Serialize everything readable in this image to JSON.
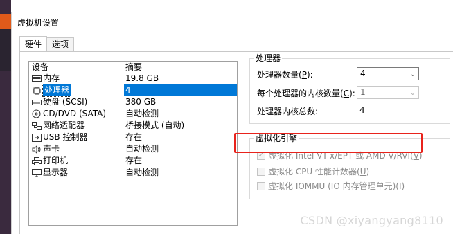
{
  "window": {
    "title": "虚拟机设置"
  },
  "tabs": [
    {
      "label": "硬件"
    },
    {
      "label": "选项"
    }
  ],
  "device_list": {
    "headers": {
      "device": "设备",
      "summary": "摘要"
    },
    "rows": [
      {
        "icon": "memory-icon",
        "name": "内存",
        "summary": "19.8 GB"
      },
      {
        "icon": "cpu-icon",
        "name": "处理器",
        "summary": "4"
      },
      {
        "icon": "hard-disk-icon",
        "name": "硬盘 (SCSI)",
        "summary": "380 GB"
      },
      {
        "icon": "cd-dvd-icon",
        "name": "CD/DVD (SATA)",
        "summary": "自动检测"
      },
      {
        "icon": "network-adapter-icon",
        "name": "网络适配器",
        "summary": "桥接模式 (自动)"
      },
      {
        "icon": "usb-controller-icon",
        "name": "USB 控制器",
        "summary": "存在"
      },
      {
        "icon": "sound-card-icon",
        "name": "声卡",
        "summary": "自动检测"
      },
      {
        "icon": "printer-icon",
        "name": "打印机",
        "summary": "存在"
      },
      {
        "icon": "display-icon",
        "name": "显示器",
        "summary": "自动检测"
      }
    ]
  },
  "processor_group": {
    "title": "处理器",
    "num_processors_label": "处理器数量(",
    "num_processors_key": "P",
    "num_processors_suffix": "):",
    "num_processors_value": "4",
    "cores_per_proc_label": "每个处理器的内核数量(",
    "cores_per_proc_key": "C",
    "cores_per_proc_suffix": "):",
    "cores_per_proc_value": "1",
    "total_cores_label": "处理器内核总数:",
    "total_cores_value": "4"
  },
  "virt_group": {
    "title": "虚拟化引擎",
    "options": [
      {
        "label": "虚拟化 Intel VT-x/EPT 或 AMD-V/RVI(",
        "key": "V",
        "suffix": ")",
        "checked": true,
        "highlighted": true
      },
      {
        "label": "虚拟化 CPU 性能计数器(",
        "key": "U",
        "suffix": ")",
        "checked": false,
        "highlighted": false
      },
      {
        "label": "虚拟化 IOMMU (IO 内存管理单元)(",
        "key": "I",
        "suffix": ")",
        "checked": false,
        "highlighted": false
      }
    ]
  },
  "watermark": "CSDN @xiyangyang8110",
  "colors": {
    "selection": "#0078d7",
    "highlight_box": "#e8231c"
  }
}
